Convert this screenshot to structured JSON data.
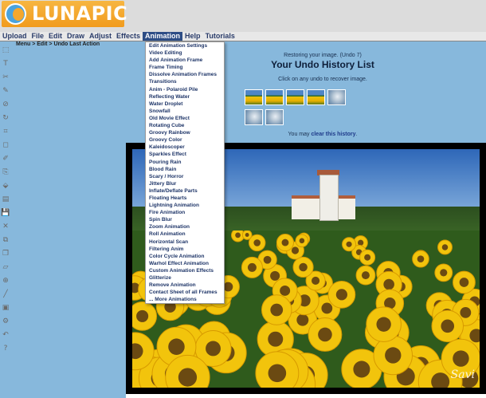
{
  "app": {
    "logo_text": "LUNAPIC"
  },
  "menubar": [
    {
      "label": "Upload",
      "active": false
    },
    {
      "label": "File",
      "active": false
    },
    {
      "label": "Edit",
      "active": false
    },
    {
      "label": "Draw",
      "active": false
    },
    {
      "label": "Adjust",
      "active": false
    },
    {
      "label": "Effects",
      "active": false
    },
    {
      "label": "Animation",
      "active": true
    },
    {
      "label": "Help",
      "active": false
    },
    {
      "label": "Tutorials",
      "active": false
    }
  ],
  "breadcrumb": "Menu > Edit > Undo Last Action",
  "tools": [
    "select-icon",
    "text-icon",
    "scissors-icon",
    "pencil-icon",
    "eyedropper-icon",
    "rotate-icon",
    "crop-icon",
    "eraser-icon",
    "brush-icon",
    "clone-icon",
    "bucket-icon",
    "gradient-icon",
    "save-icon",
    "close-icon",
    "copy-icon",
    "layers-icon",
    "shape-icon",
    "zoom-icon",
    "line-icon",
    "frame-icon",
    "settings-icon",
    "undo-icon",
    "help-icon"
  ],
  "dropdown": [
    "Edit Animation Settings",
    "Video Editing",
    "Add Animation Frame",
    "Frame Timing",
    "Dissolve Animation Frames",
    "Transitions",
    "Anim - Polaroid Pile",
    "Reflecting Water",
    "Water Droplet",
    "Snowfall",
    "Old Movie Effect",
    "Rotating Cube",
    "Groovy Rainbow",
    "Groovy Color",
    "Kaleidoscoper",
    "Sparkles Effect",
    "Pouring Rain",
    "Blood Rain",
    "Scary / Horror",
    "Jittery Blur",
    "Inflate/Deflate Parts",
    "Floating Hearts",
    "Lightning Animation",
    "Fire Animation",
    "Spin Blur",
    "Zoom Animation",
    "Roll Animation",
    "Horizontal Scan",
    "Filtering Anim",
    "Color Cycle Animation",
    "Warhol Effect Animation",
    "Custom Animation Effects",
    "Glitterize",
    "Remove Animation",
    "Contact Sheet of all Frames",
    "... More Animations"
  ],
  "undo": {
    "status": "Restoring your image. (Undo 7)",
    "title": "Your Undo History List",
    "hint": "Click on any undo to recover image.",
    "clear_prefix": "You may",
    "clear_link": "clear this history",
    "clear_suffix": "."
  },
  "thumbnails": [
    "sunflowers",
    "sunflowers",
    "sunflowers",
    "sunflowers",
    "sky",
    "sky",
    "sky"
  ],
  "watermark": "Savi"
}
